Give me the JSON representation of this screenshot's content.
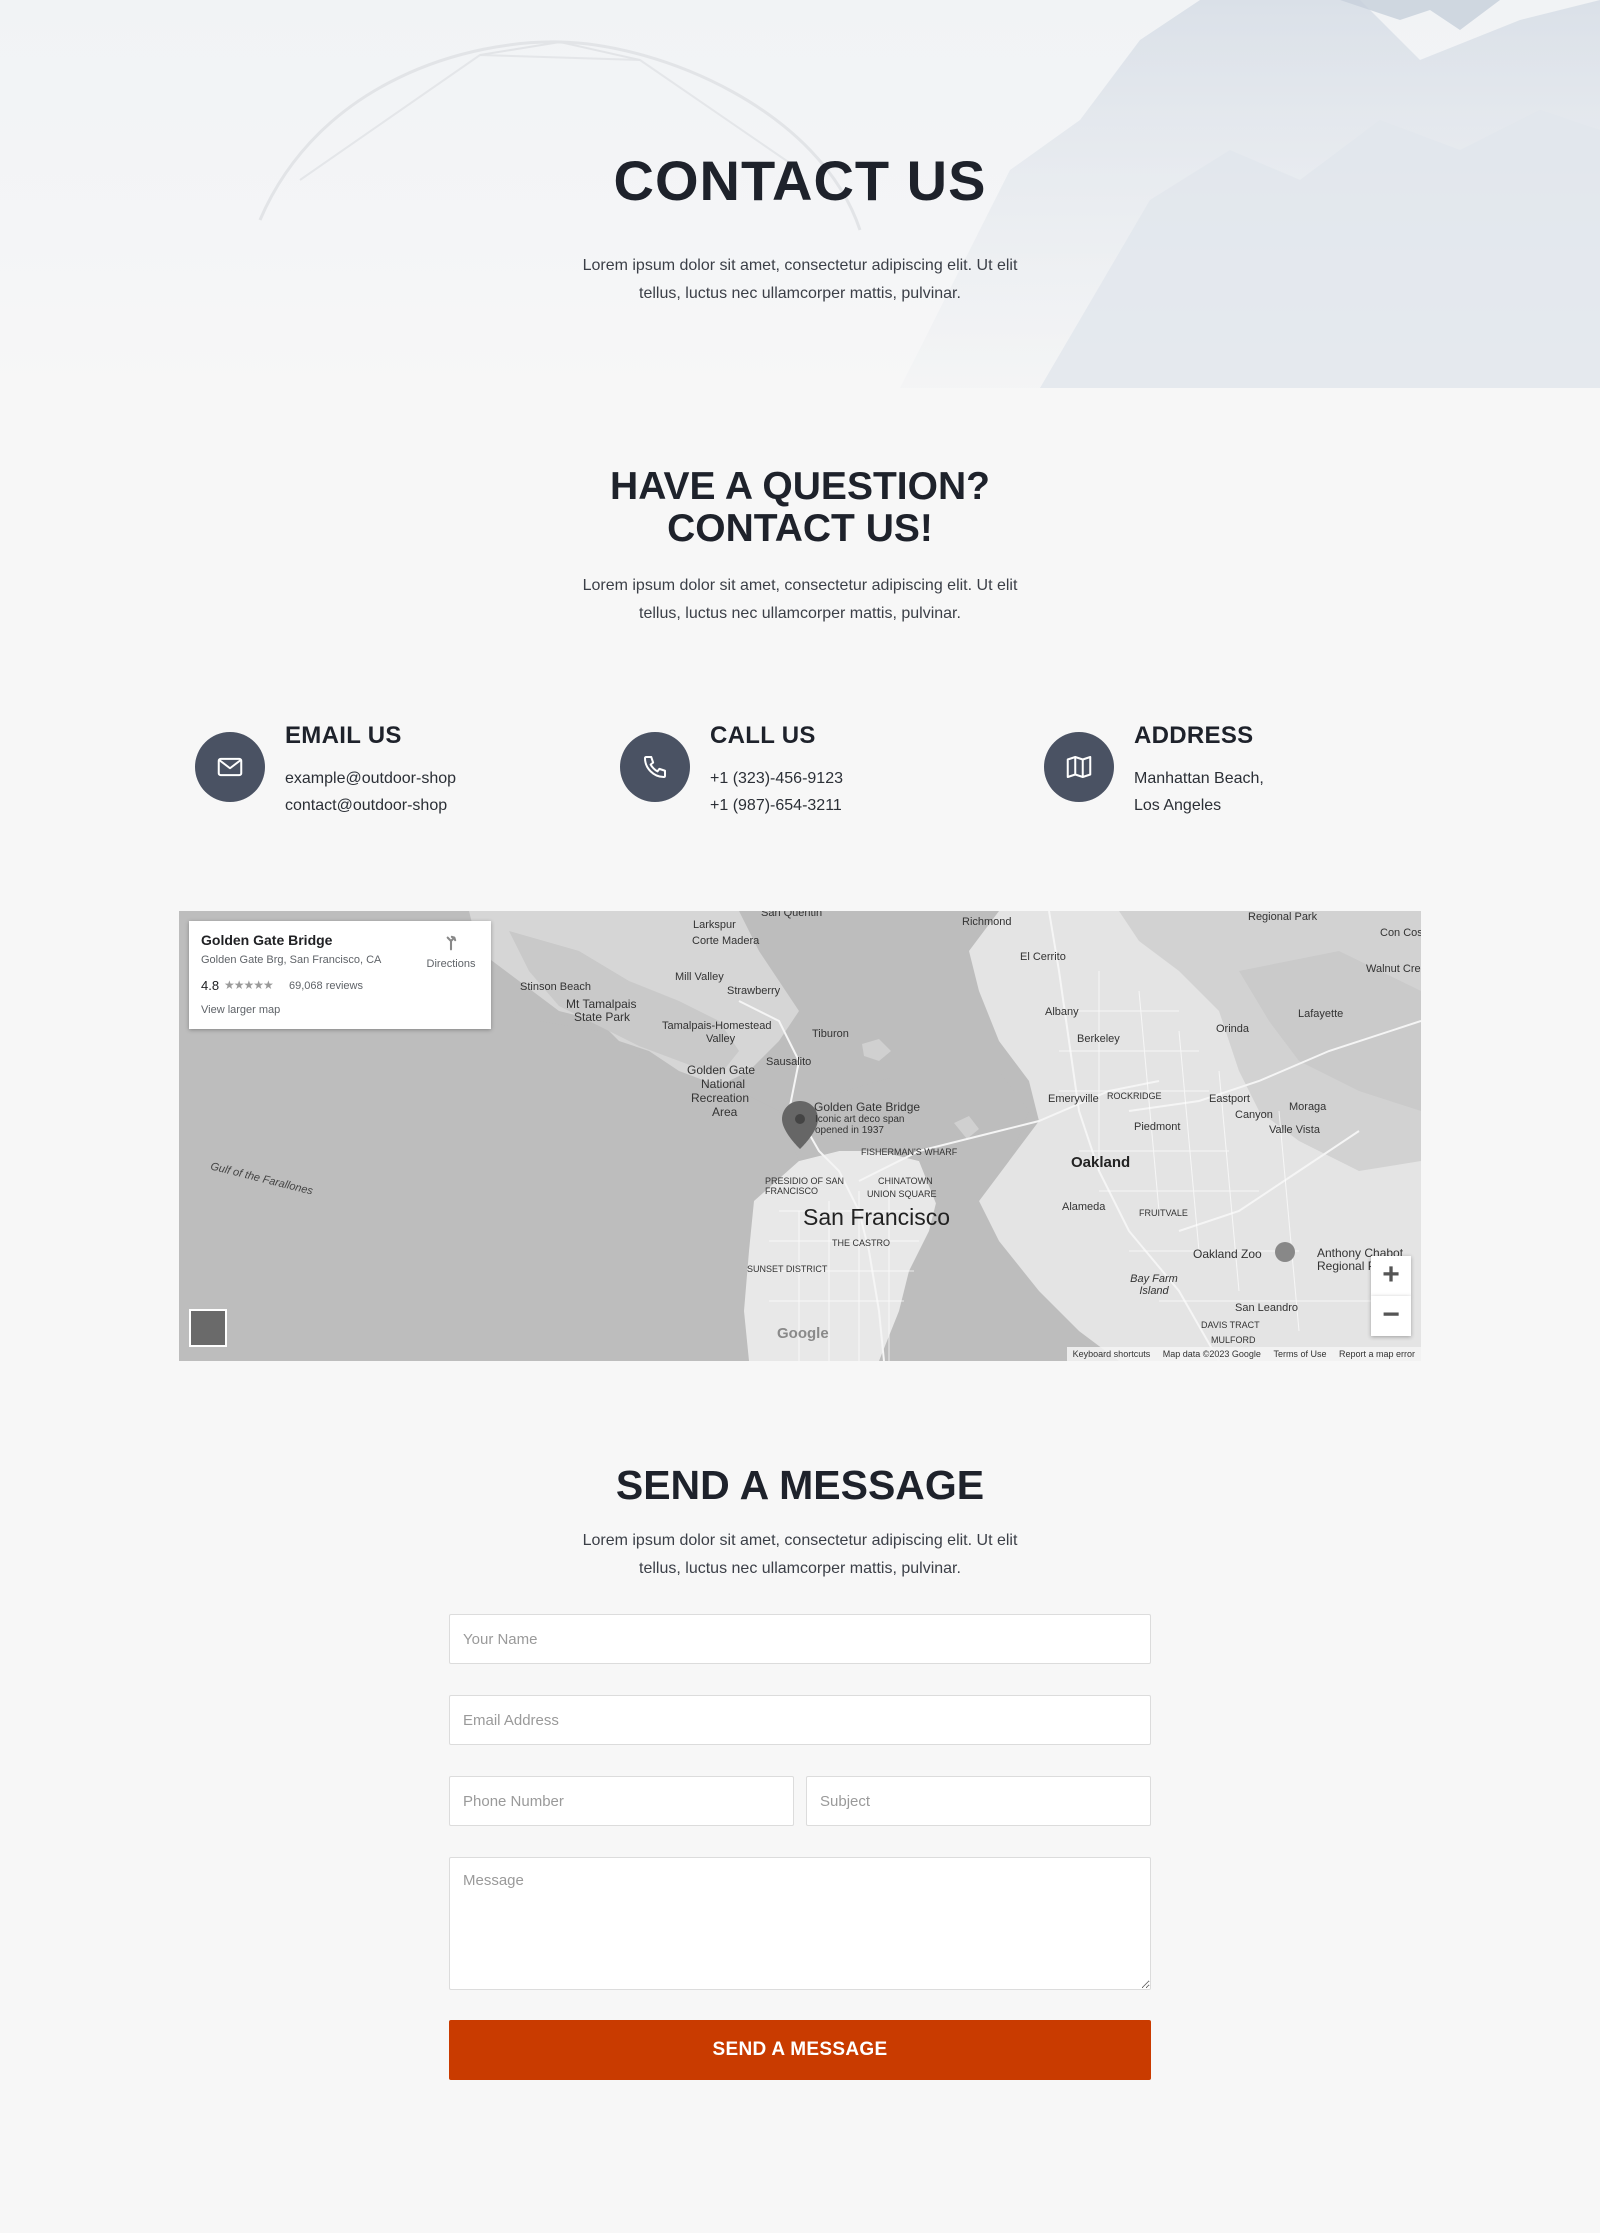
{
  "hero": {
    "title": "CONTACT US",
    "lead": "Lorem ipsum dolor sit amet, consectetur adipiscing elit. Ut elit tellus, luctus nec ullamcorper mattis, pulvinar."
  },
  "question": {
    "title_line1": "HAVE A QUESTION?",
    "title_line2": "CONTACT US!",
    "lead": "Lorem ipsum dolor sit amet, consectetur adipiscing elit. Ut elit tellus, luctus nec ullamcorper mattis, pulvinar."
  },
  "contact": {
    "accent_color": "#4a5263",
    "email": {
      "icon": "envelope-icon",
      "heading": "EMAIL US",
      "line1": "example@outdoor-shop",
      "line2": "contact@outdoor-shop"
    },
    "call": {
      "icon": "phone-icon",
      "heading": "CALL US",
      "line1": "+1 (323)-456-9123",
      "line2": "+1 (987)-654-3211"
    },
    "address": {
      "icon": "map-icon",
      "heading": "ADDRESS",
      "line1": "Manhattan Beach,",
      "line2": "Los Angeles"
    }
  },
  "map": {
    "card": {
      "title": "Golden Gate Bridge",
      "address": "Golden Gate Brg, San Francisco, CA",
      "rating": "4.8",
      "stars": "★★★★★",
      "reviews": "69,068 reviews",
      "view_larger": "View larger map",
      "directions": "Directions"
    },
    "labels": {
      "san_francisco": "San Francisco",
      "oakland": "Oakland",
      "golden_gate_bridge": "Golden Gate Bridge",
      "iconic": "Iconic art deco span",
      "opened": "opened in 1937",
      "sausalito": "Sausalito",
      "richmond": "Richmond",
      "berkeley": "Berkeley",
      "albany": "Albany",
      "alameda": "Alameda",
      "emeryville": "Emeryville",
      "piedmont": "Piedmont",
      "orinda": "Orinda",
      "lafayette": "Lafayette",
      "moraga": "Moraga",
      "tiburon": "Tiburon",
      "mill_valley": "Mill Valley",
      "strawberry": "Strawberry",
      "larkspur": "Larkspur",
      "corte_madera": "Corte Madera",
      "stinson_beach": "Stinson Beach",
      "mt_tamalpais": "Mt Tamalpais",
      "state_park": "State Park",
      "tamalpais_homestead": "Tamalpais-Homestead",
      "valley": "Valley",
      "ggnra1": "Golden Gate",
      "ggnra2": "National",
      "ggnra3": "Recreation",
      "ggnra4": "Area",
      "fishermans_wharf": "FISHERMAN'S WHARF",
      "chinatown": "CHINATOWN",
      "union_square": "UNION SQUARE",
      "presidio": "PRESIDIO OF SAN FRANCISCO",
      "the_castro": "THE CASTRO",
      "sunset_district": "SUNSET DISTRICT",
      "gulf": "Gulf of the Farallones",
      "el_cerrito": "El Cerrito",
      "regional_park": "Regional Park",
      "oakland_zoo": "Oakland Zoo",
      "anthony_chabot": "Anthony Chabot Regional Pa",
      "bay_farm": "Bay Farm Island",
      "san_leandro": "San Leandro",
      "eastport": "Eastport",
      "canyon": "Canyon",
      "valle_vista": "Valle Vista",
      "rockridge": "ROCKRIDGE",
      "fruitvale": "FRUITVALE",
      "davis_tract": "DAVIS TRACT",
      "mulford": "MULFORD",
      "walnut_creek": "Walnut Cre",
      "san_quentin": "San Quentin",
      "contra_costa": "Con Costa C"
    },
    "zoom_in": "+",
    "zoom_out": "−",
    "google": "Google",
    "attribution": {
      "keyboard": "Keyboard shortcuts",
      "map_data": "Map data ©2023 Google",
      "terms": "Terms of Use",
      "report": "Report a map error"
    }
  },
  "send": {
    "title": "SEND A MESSAGE",
    "lead": "Lorem ipsum dolor sit amet, consectetur adipiscing elit. Ut elit tellus, luctus nec ullamcorper mattis, pulvinar.",
    "name_placeholder": "Your Name",
    "email_placeholder": "Email Address",
    "phone_placeholder": "Phone Number",
    "subject_placeholder": "Subject",
    "message_placeholder": "Message",
    "button_label": "SEND A MESSAGE",
    "button_color": "#c93b00"
  }
}
